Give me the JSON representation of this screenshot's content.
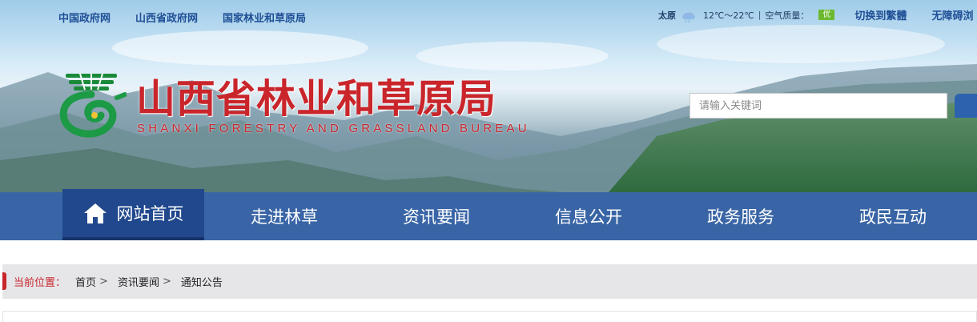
{
  "header": {
    "top_links": [
      "中国政府网",
      "山西省政府网",
      "国家林业和草原局"
    ],
    "weather": {
      "city": "太原",
      "icon": "cloud-rain-icon",
      "temperature": "12℃～22℃",
      "separator": "|",
      "air_quality_label": "空气质量：",
      "air_quality_value": "优"
    },
    "switch_label": "切换到繁體",
    "accessibility_label": "无障碍浏",
    "site_title": "山西省林业和草原局",
    "site_subtitle": "SHANXI FORESTRY AND GRASSLAND BUREAU",
    "search_placeholder": "请输入关键词"
  },
  "nav": {
    "items": [
      "网站首页",
      "走进林草",
      "资讯要闻",
      "信息公开",
      "政务服务",
      "政民互动"
    ],
    "active_index": 0
  },
  "breadcrumb": {
    "label": "当前位置：",
    "items": [
      "首页",
      "资讯要闻",
      "通知公告"
    ],
    "separator": ">"
  },
  "colors": {
    "brand_red": "#c9252b",
    "nav_blue": "#3965a6",
    "nav_active": "#21488d",
    "link_blue": "#1f4f95",
    "badge_green": "#6cb92f"
  }
}
